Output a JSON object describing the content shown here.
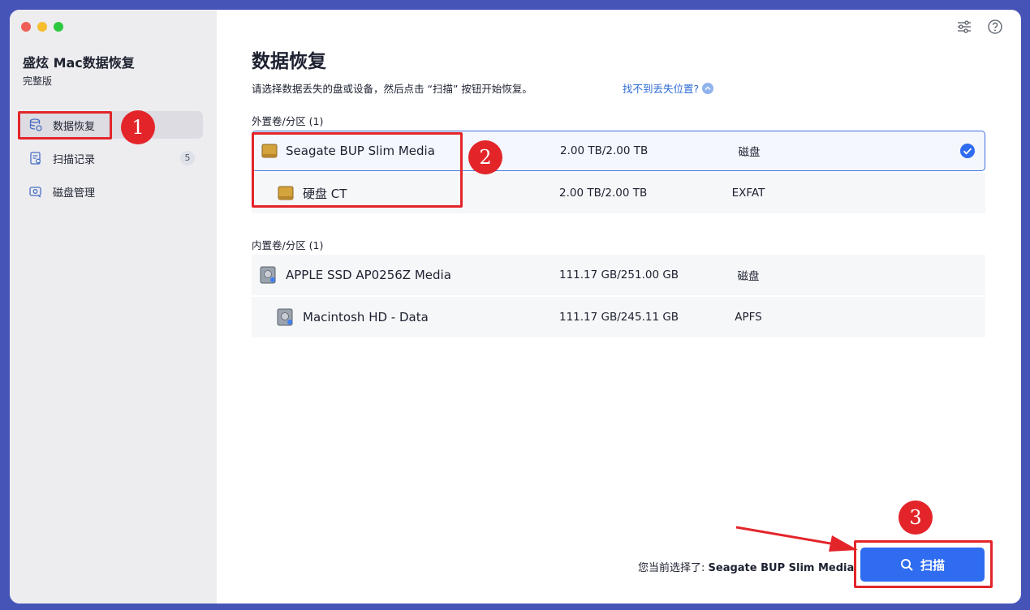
{
  "app": {
    "title": "盛炫 Mac数据恢复",
    "edition": "完整版"
  },
  "sidebar": {
    "items": [
      {
        "label": "数据恢复",
        "icon": "database-restore-icon",
        "active": true
      },
      {
        "label": "扫描记录",
        "icon": "scan-record-icon",
        "badge": "5"
      },
      {
        "label": "磁盘管理",
        "icon": "disk-manage-icon"
      }
    ]
  },
  "topbar": {
    "icons": [
      "settings-sliders-icon",
      "help-icon"
    ]
  },
  "main": {
    "title": "数据恢复",
    "subtitle": "请选择数据丢失的盘或设备，然后点击 “扫描” 按钮开始恢复。",
    "help_link": "找不到丢失位置?",
    "external_section": "外置卷/分区 (1)",
    "internal_section": "内置卷/分区 (1)",
    "external": [
      {
        "name": "Seagate BUP Slim Media",
        "size": "2.00 TB/2.00 TB",
        "fs": "磁盘",
        "selected": true
      },
      {
        "name": "硬盘 CT",
        "size": "2.00 TB/2.00 TB",
        "fs": "EXFAT"
      }
    ],
    "internal": [
      {
        "name": "APPLE SSD AP0256Z Media",
        "size": "111.17 GB/251.00 GB",
        "fs": "磁盘"
      },
      {
        "name": "Macintosh HD - Data",
        "size": "111.17 GB/245.11 GB",
        "fs": "APFS"
      }
    ],
    "current_selection_label": "您当前选择了:",
    "current_selection_value": "Seagate BUP Slim Media",
    "scan_label": "扫描"
  },
  "annotations": [
    "1",
    "2",
    "3"
  ],
  "colors": {
    "accent": "#2f6cf0",
    "annotation": "#e3252a",
    "frame": "#4654b8"
  }
}
